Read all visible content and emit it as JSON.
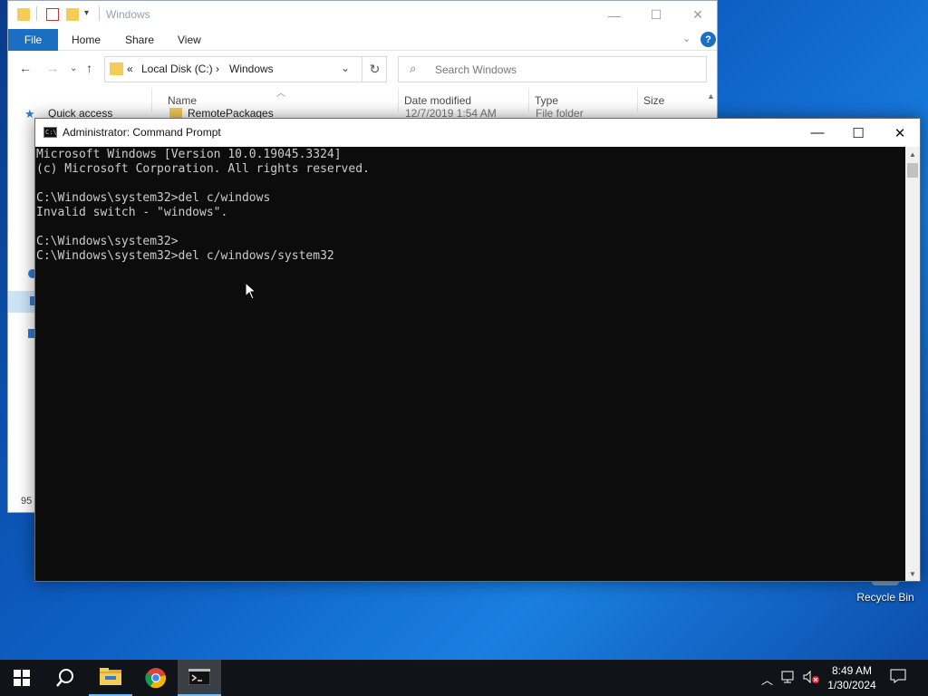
{
  "desktop": {
    "recycle_bin_label": "Recycle Bin"
  },
  "explorer": {
    "title": "Windows",
    "ribbon": {
      "file": "File",
      "home": "Home",
      "share": "Share",
      "view": "View"
    },
    "address": {
      "chevrons": "«",
      "drive": "Local Disk (C:)",
      "separator": "›",
      "folder": "Windows"
    },
    "search_placeholder": "Search Windows",
    "columns": {
      "name": "Name",
      "date": "Date modified",
      "type": "Type",
      "size": "Size"
    },
    "nav": {
      "quick_access": "Quick access"
    },
    "rows": [
      {
        "name": "RemotePackages",
        "date": "12/7/2019 1:54 AM",
        "type": "File folder"
      }
    ],
    "status_count": "95"
  },
  "cmd": {
    "title": "Administrator: Command Prompt",
    "lines": [
      "Microsoft Windows [Version 10.0.19045.3324]",
      "(c) Microsoft Corporation. All rights reserved.",
      "",
      "C:\\Windows\\system32>del c/windows",
      "Invalid switch - \"windows\".",
      "",
      "C:\\Windows\\system32>",
      "C:\\Windows\\system32>del c/windows/system32"
    ]
  },
  "taskbar": {
    "time": "8:49 AM",
    "date": "1/30/2024",
    "apps": [
      "start",
      "search",
      "file-explorer",
      "chrome",
      "command-prompt"
    ]
  }
}
